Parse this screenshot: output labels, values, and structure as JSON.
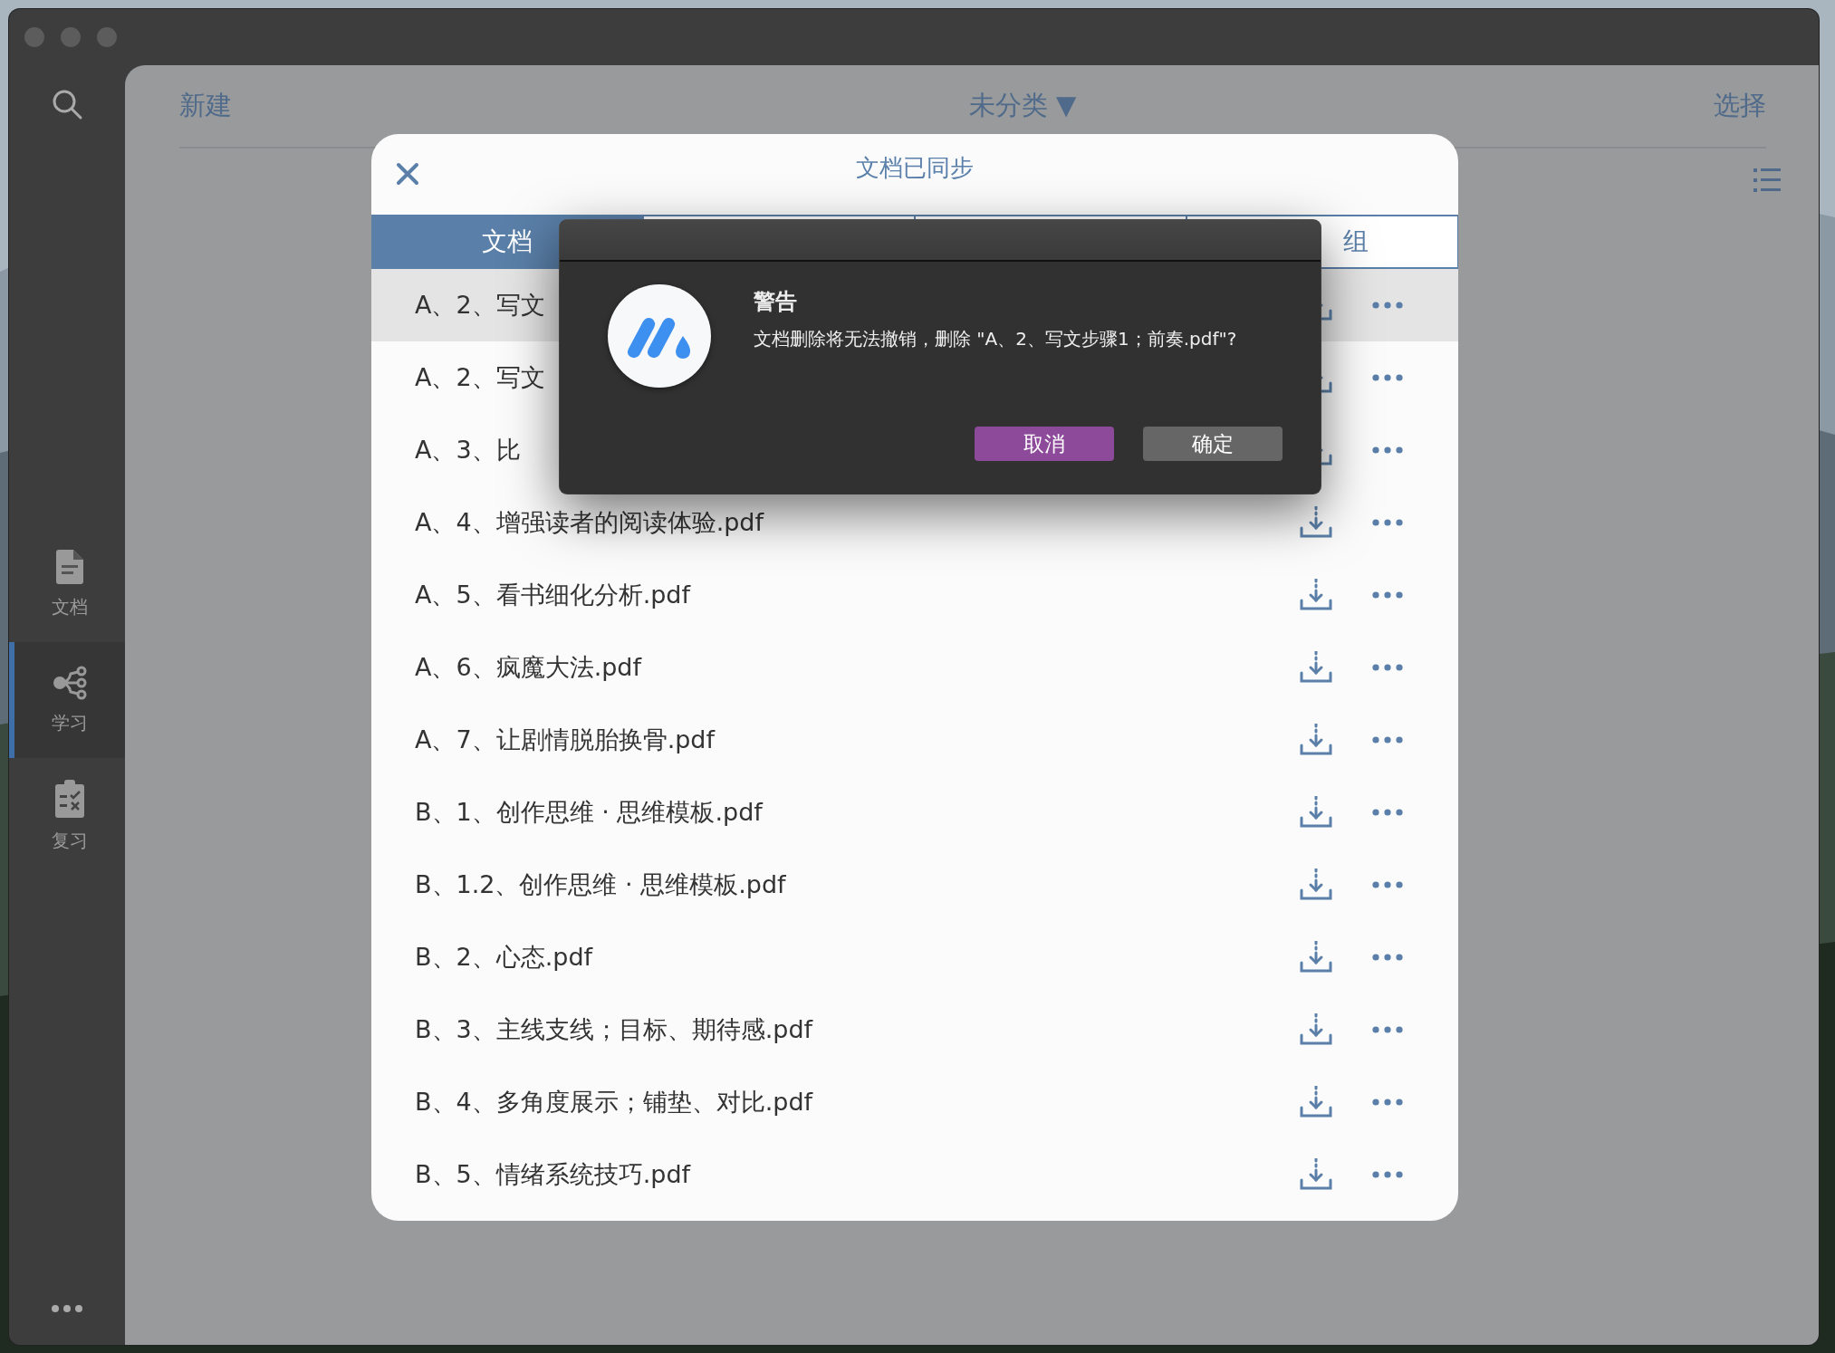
{
  "sidebar": {
    "items": [
      {
        "kind": "document",
        "label": "文档",
        "selected": false
      },
      {
        "kind": "branch",
        "label": "学习",
        "selected": true
      },
      {
        "kind": "review",
        "label": "复习",
        "selected": false
      }
    ]
  },
  "toolbar": {
    "new": "新建",
    "category": "未分类 ▼",
    "select": "选择"
  },
  "dialog": {
    "title": "文档已同步",
    "tabs": [
      {
        "label": "文档",
        "selected": true
      },
      {
        "selected": false
      },
      {
        "selected": false
      },
      {
        "label": "组",
        "selected": false
      }
    ],
    "rows": [
      {
        "name": "A、2、写文",
        "selected": true
      },
      {
        "name": "A、2、写文",
        "selected": false
      },
      {
        "name": "A、3、比",
        "selected": false
      },
      {
        "name": "A、4、增强读者的阅读体验.pdf",
        "selected": false
      },
      {
        "name": "A、5、看书细化分析.pdf",
        "selected": false
      },
      {
        "name": "A、6、疯魔大法.pdf",
        "selected": false
      },
      {
        "name": "A、7、让剧情脱胎换骨.pdf",
        "selected": false
      },
      {
        "name": "B、1、创作思维 · 思维模板.pdf",
        "selected": false
      },
      {
        "name": "B、1.2、创作思维 · 思维模板.pdf",
        "selected": false
      },
      {
        "name": "B、2、心态.pdf",
        "selected": false
      },
      {
        "name": "B、3、主线支线；目标、期待感.pdf",
        "selected": false
      },
      {
        "name": "B、4、多角度展示；铺垫、对比.pdf",
        "selected": false
      },
      {
        "name": "B、5、情绪系统技巧.pdf",
        "selected": false
      }
    ]
  },
  "alert": {
    "title": "警告",
    "message": "文档删除将无法撤销，删除 \"A、2、写文步骤1；前奏.pdf\"?",
    "buttons": [
      {
        "label": "取消",
        "kind": "primary"
      },
      {
        "label": "确定",
        "kind": "secondary"
      }
    ]
  }
}
